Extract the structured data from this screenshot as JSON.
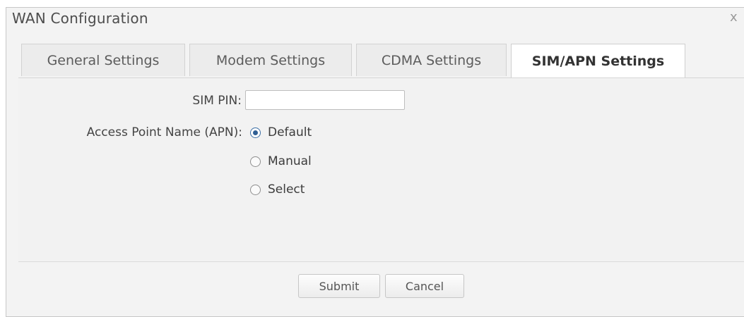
{
  "dialog": {
    "title": "WAN Configuration",
    "close_glyph": "x"
  },
  "tabs": [
    {
      "label": "General Settings",
      "active": false
    },
    {
      "label": "Modem Settings",
      "active": false
    },
    {
      "label": "CDMA Settings",
      "active": false
    },
    {
      "label": "SIM/APN Settings",
      "active": true
    }
  ],
  "form": {
    "sim_pin_label": "SIM PIN:",
    "sim_pin_value": "",
    "apn_label": "Access Point Name (APN):",
    "apn_options": [
      {
        "label": "Default",
        "checked": true
      },
      {
        "label": "Manual",
        "checked": false
      },
      {
        "label": "Select",
        "checked": false
      }
    ]
  },
  "buttons": {
    "submit": "Submit",
    "cancel": "Cancel"
  },
  "icons": {
    "close": "close-icon",
    "radio": "radio-button-icon"
  }
}
